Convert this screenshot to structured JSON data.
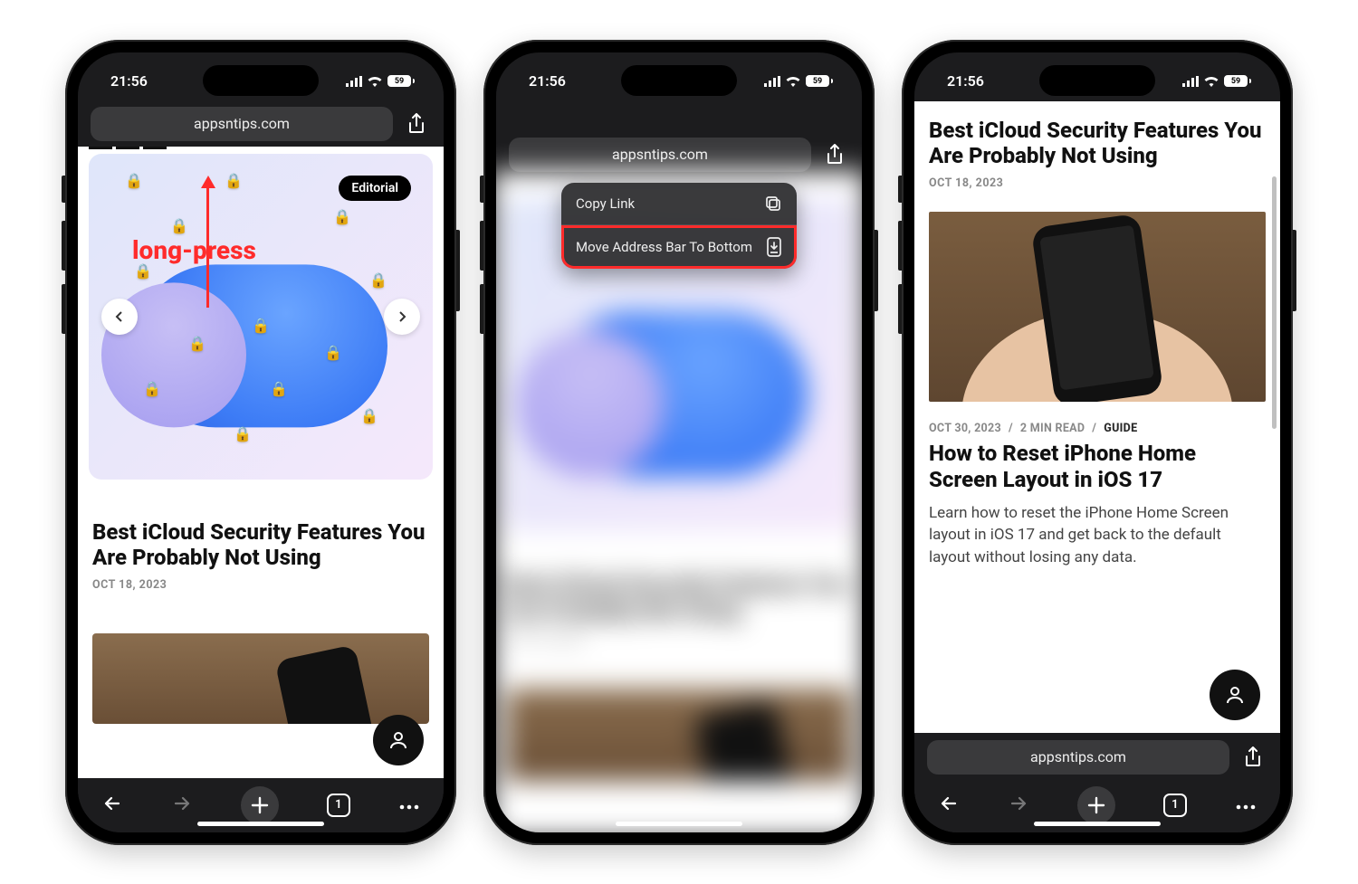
{
  "status": {
    "time": "21:56",
    "battery_pct": "59"
  },
  "safari": {
    "domain": "appsntips.com",
    "tab_count": "1"
  },
  "annotations": {
    "longpress": "long-press",
    "editorial_tag": "Editorial"
  },
  "menu": {
    "copy_link": "Copy Link",
    "move_addr": "Move Address Bar To Bottom"
  },
  "post1": {
    "title": "Best iCloud Security Features You Are Probably Not Using",
    "date": "OCT 18, 2023"
  },
  "post2": {
    "meta_date": "OCT 30, 2023",
    "meta_read": "2 MIN READ",
    "meta_cat": "GUIDE",
    "title": "How to Reset iPhone Home Screen Layout in iOS 17",
    "excerpt": "Learn how to reset the iPhone Home Screen layout in iOS 17 and get back to the default layout without losing any data.",
    "slash": "/"
  }
}
